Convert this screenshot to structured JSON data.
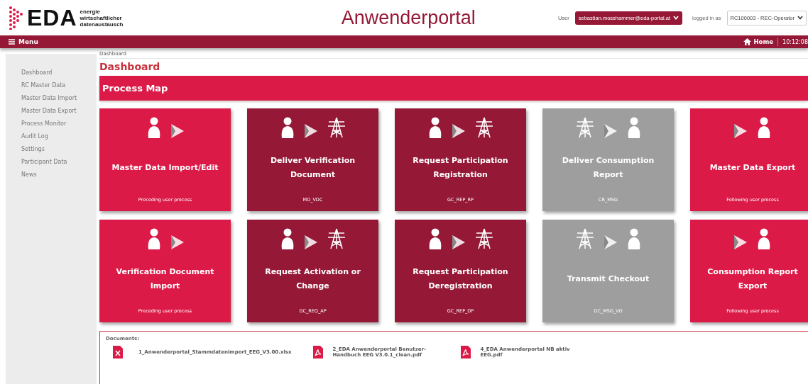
{
  "logo": {
    "mark": "EDA",
    "tagline": [
      "energie",
      "wirtschaftlicher",
      "datenaustausch"
    ]
  },
  "portal_title": "Anwenderportal",
  "user": {
    "label": "User",
    "value": "sebastian.mosshammer@eda-portal.at",
    "role_label": "logged in as",
    "role": "RC100003 - REC-Operator"
  },
  "menu_bar": {
    "menu": "Menu",
    "home": "Home",
    "time": "10:12:08"
  },
  "sidebar": {
    "items": [
      {
        "label": "Dashboard"
      },
      {
        "label": "RC Master Data"
      },
      {
        "label": "Master Data Import"
      },
      {
        "label": "Master Data Export"
      },
      {
        "label": "Process Monitor"
      },
      {
        "label": "Audit Log"
      },
      {
        "label": "Settings"
      },
      {
        "label": "Participant Data"
      },
      {
        "label": "News"
      }
    ]
  },
  "breadcrumb": "Dashboard",
  "page_title": "Dashboard",
  "section_title": "Process Map",
  "tiles": [
    {
      "kind": "user",
      "icons": [
        {
          "kind": "person"
        },
        {
          "kind": "play"
        }
      ],
      "title": "Master Data Import/Edit",
      "caption": "Preceding user process"
    },
    {
      "kind": "process",
      "icons": [
        {
          "kind": "person"
        },
        {
          "kind": "play"
        },
        {
          "kind": "tower"
        }
      ],
      "title": "Deliver Verification Document",
      "caption": "MD_VDC"
    },
    {
      "kind": "process",
      "icons": [
        {
          "kind": "person"
        },
        {
          "kind": "play"
        },
        {
          "kind": "tower"
        }
      ],
      "title": "Request Participation Registration",
      "caption": "GC_REP_RP"
    },
    {
      "kind": "inactive",
      "icons": [
        {
          "kind": "tower"
        },
        {
          "kind": "play"
        },
        {
          "kind": "person"
        }
      ],
      "title": "Deliver Consumption Report",
      "caption": "CR_MSG"
    },
    {
      "kind": "user",
      "icons": [
        {
          "kind": "play"
        },
        {
          "kind": "person"
        }
      ],
      "title": "Master Data Export",
      "caption": "Following user process"
    },
    {
      "kind": "user",
      "icons": [
        {
          "kind": "person"
        },
        {
          "kind": "play"
        }
      ],
      "title": "Verification Document Import",
      "caption": "Preceding user process"
    },
    {
      "kind": "process",
      "icons": [
        {
          "kind": "person"
        },
        {
          "kind": "play"
        },
        {
          "kind": "tower"
        }
      ],
      "title": "Request Activation or Change",
      "caption": "GC_REQ_AP"
    },
    {
      "kind": "process",
      "icons": [
        {
          "kind": "person"
        },
        {
          "kind": "play"
        },
        {
          "kind": "tower"
        }
      ],
      "title": "Request Participation Deregistration",
      "caption": "GC_REP_DP"
    },
    {
      "kind": "inactive",
      "icons": [
        {
          "kind": "tower"
        },
        {
          "kind": "play"
        },
        {
          "kind": "person"
        }
      ],
      "title": "Transmit Checkout",
      "caption": "GC_MSG_VO"
    },
    {
      "kind": "user",
      "icons": [
        {
          "kind": "play"
        },
        {
          "kind": "person"
        }
      ],
      "title": "Consumption Report Export",
      "caption": "Following user process"
    }
  ],
  "documents": {
    "label": "Documents:",
    "files": [
      {
        "kind": "xlsx",
        "name": "1_Anwenderportal_Stammdatenimport_EEG_V3.00.xlsx"
      },
      {
        "kind": "pdf",
        "name": "2_EDA Anwenderportal Benutzer-Handbuch EEG V3.0.1_clean.pdf"
      },
      {
        "kind": "pdf",
        "name": "4_EDA Anwenderportal NB aktiv EEG.pdf"
      }
    ]
  }
}
